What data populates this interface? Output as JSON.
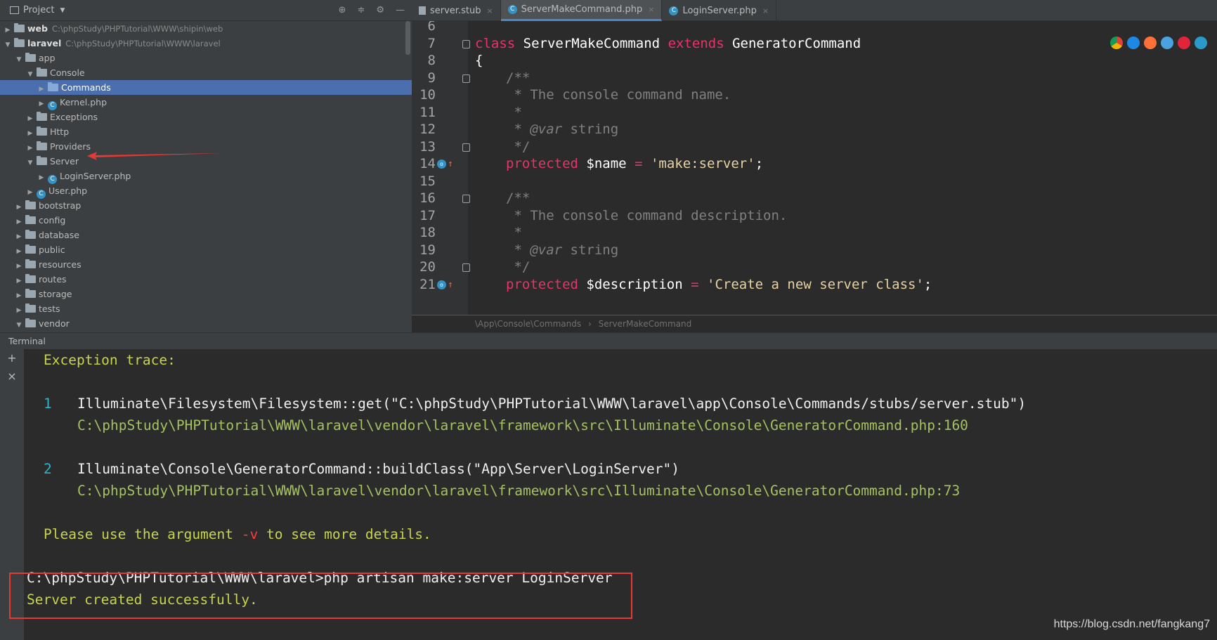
{
  "project_panel": {
    "title": "Project",
    "tree": [
      {
        "label": "web",
        "path": "C:\\phpStudy\\PHPTutorial\\WWW\\shipin\\web",
        "depth": 0,
        "type": "folder",
        "expanded": false,
        "bold": true
      },
      {
        "label": "laravel",
        "path": "C:\\phpStudy\\PHPTutorial\\WWW\\laravel",
        "depth": 0,
        "type": "folder",
        "expanded": true,
        "bold": true
      },
      {
        "label": "app",
        "depth": 1,
        "type": "folder",
        "expanded": true
      },
      {
        "label": "Console",
        "depth": 2,
        "type": "folder",
        "expanded": true
      },
      {
        "label": "Commands",
        "depth": 3,
        "type": "folder",
        "expanded": false,
        "selected": true
      },
      {
        "label": "Kernel.php",
        "depth": 3,
        "type": "class",
        "expanded": false
      },
      {
        "label": "Exceptions",
        "depth": 2,
        "type": "folder",
        "expanded": false
      },
      {
        "label": "Http",
        "depth": 2,
        "type": "folder",
        "expanded": false
      },
      {
        "label": "Providers",
        "depth": 2,
        "type": "folder",
        "expanded": false
      },
      {
        "label": "Server",
        "depth": 2,
        "type": "folder",
        "expanded": true
      },
      {
        "label": "LoginServer.php",
        "depth": 3,
        "type": "class",
        "expanded": false
      },
      {
        "label": "User.php",
        "depth": 2,
        "type": "class",
        "expanded": false
      },
      {
        "label": "bootstrap",
        "depth": 1,
        "type": "folder",
        "expanded": false
      },
      {
        "label": "config",
        "depth": 1,
        "type": "folder",
        "expanded": false
      },
      {
        "label": "database",
        "depth": 1,
        "type": "folder",
        "expanded": false
      },
      {
        "label": "public",
        "depth": 1,
        "type": "folder",
        "expanded": false
      },
      {
        "label": "resources",
        "depth": 1,
        "type": "folder",
        "expanded": false
      },
      {
        "label": "routes",
        "depth": 1,
        "type": "folder",
        "expanded": false
      },
      {
        "label": "storage",
        "depth": 1,
        "type": "folder",
        "expanded": false
      },
      {
        "label": "tests",
        "depth": 1,
        "type": "folder",
        "expanded": false
      },
      {
        "label": "vendor",
        "depth": 1,
        "type": "folder",
        "expanded": true
      }
    ]
  },
  "editor": {
    "tabs": [
      {
        "label": "server.stub",
        "active": false,
        "icon": "file-icon"
      },
      {
        "label": "ServerMakeCommand.php",
        "active": true,
        "icon": "class-icon"
      },
      {
        "label": "LoginServer.php",
        "active": false,
        "icon": "class-icon"
      }
    ],
    "lines": [
      {
        "n": "6",
        "html": ""
      },
      {
        "n": "7",
        "html": "<span class=\"kw2\">class</span> <span class=\"plain\">ServerMakeCommand</span> <span class=\"kw2\">extends</span> <span class=\"plain\">GeneratorCommand</span>",
        "indent": 0,
        "fold": true
      },
      {
        "n": "8",
        "html": "<span class=\"plain\">{</span>",
        "indent": 0
      },
      {
        "n": "9",
        "html": "<span class=\"cm\">/**</span>",
        "indent": 1,
        "fold": true
      },
      {
        "n": "10",
        "html": "<span class=\"cm\"> * The console command name.</span>",
        "indent": 1
      },
      {
        "n": "11",
        "html": "<span class=\"cm\"> *</span>",
        "indent": 1
      },
      {
        "n": "12",
        "html": "<span class=\"cm\"> * </span><span class=\"cmtag\">@var</span><span class=\"cm\"> string</span>",
        "indent": 1
      },
      {
        "n": "13",
        "html": "<span class=\"cm\"> */</span>",
        "indent": 1,
        "fold": true
      },
      {
        "n": "14",
        "html": "<span class=\"kw2\">protected</span> <span class=\"plain\">$name</span> <span class=\"op\">=</span> <span class=\"str2\">'make:server'</span><span class=\"plain\">;</span>",
        "indent": 1,
        "override": true
      },
      {
        "n": "15",
        "html": ""
      },
      {
        "n": "16",
        "html": "<span class=\"cm\">/**</span>",
        "indent": 1,
        "fold": true
      },
      {
        "n": "17",
        "html": "<span class=\"cm\"> * The console command description.</span>",
        "indent": 1
      },
      {
        "n": "18",
        "html": "<span class=\"cm\"> *</span>",
        "indent": 1
      },
      {
        "n": "19",
        "html": "<span class=\"cm\"> * </span><span class=\"cmtag\">@var</span><span class=\"cm\"> string</span>",
        "indent": 1
      },
      {
        "n": "20",
        "html": "<span class=\"cm\"> */</span>",
        "indent": 1,
        "fold": true
      },
      {
        "n": "21",
        "html": "<span class=\"kw2\">protected</span> <span class=\"plain\">$description</span> <span class=\"op\">=</span> <span class=\"str2\">'Create a new server class'</span><span class=\"plain\">;</span>",
        "indent": 1,
        "override": true
      }
    ],
    "breadcrumb": {
      "part1": "\\App\\Console\\Commands",
      "separator": "›",
      "part2": "ServerMakeCommand"
    },
    "browser_icons": [
      "chrome-icon",
      "ie-icon",
      "firefox-icon",
      "safari-icon",
      "opera-icon",
      "edge-icon"
    ]
  },
  "terminal": {
    "title": "Terminal",
    "add_icon": "+",
    "close_icon": "×",
    "exception_heading": "Exception trace:",
    "trace": [
      {
        "num": "1",
        "call": "Illuminate\\Filesystem\\Filesystem::get(\"C:\\phpStudy\\PHPTutorial\\WWW\\laravel\\app\\Console\\Commands/stubs/server.stub\")",
        "location": "C:\\phpStudy\\PHPTutorial\\WWW\\laravel\\vendor\\laravel\\framework\\src\\Illuminate\\Console\\GeneratorCommand.php:160"
      },
      {
        "num": "2",
        "call": "Illuminate\\Console\\GeneratorCommand::buildClass(\"App\\Server\\LoginServer\")",
        "location": "C:\\phpStudy\\PHPTutorial\\WWW\\laravel\\vendor\\laravel\\framework\\src\\Illuminate\\Console\\GeneratorCommand.php:73"
      }
    ],
    "hint_before": "Please use the argument ",
    "hint_flag": "-v",
    "hint_after": " to see more details.",
    "prompt": "C:\\phpStudy\\PHPTutorial\\WWW\\laravel>php artisan make:server LoginServer",
    "result": "Server created successfully."
  },
  "watermark": "https://blog.csdn.net/fangkang7",
  "colors": {
    "selection": "#4b6eaf",
    "highlight_box": "#e53935",
    "keyword": "#e8336a",
    "comment": "#808080"
  }
}
